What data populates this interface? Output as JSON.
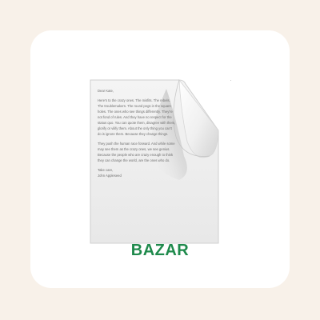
{
  "app": {
    "name": "BAZAR",
    "name_color": "#1f8a4c",
    "icon": "document-icon"
  },
  "document": {
    "salutation": "Dear Kate,",
    "paragraph_1": "Here's to the crazy ones. The misfits. The rebels.\nThe troublemakers. The round pegs in the square\nholes. The ones who see things differently. They're\nnot fond of rules. And they have no respect for the\nstatus quo. You can quote them, disagree with them,\nglorify or vilify them. About the only thing you can't\ndo is ignore them. Because they change things.",
    "paragraph_2": "They push the human race forward. And while some\nmay see them as the crazy ones, we see genius.\nBecause the people who are crazy enough to think\nthey can change the world, are the ones who do.",
    "closing": "Take care,",
    "signature": "John Appleseed"
  },
  "colors": {
    "page_background": "#f8f1e9",
    "card_background": "#ffffff"
  }
}
